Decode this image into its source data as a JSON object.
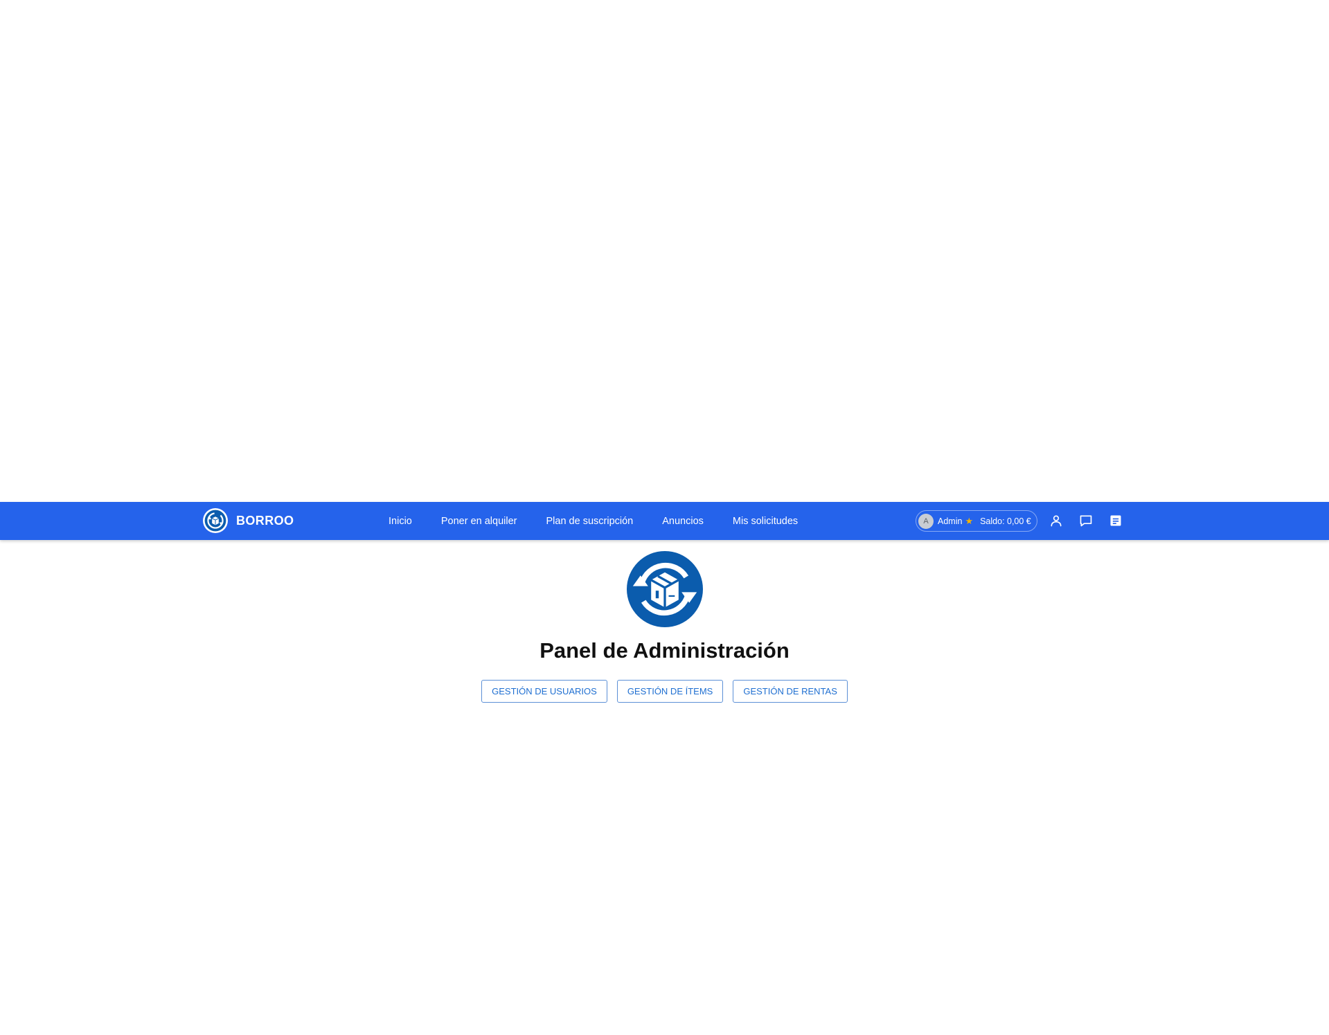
{
  "brand": {
    "name": "BORROO",
    "logo_icon": "borroo-box-cycle-icon"
  },
  "nav": {
    "links": [
      {
        "label": "Inicio"
      },
      {
        "label": "Poner en alquiler"
      },
      {
        "label": "Plan de suscripción"
      },
      {
        "label": "Anuncios"
      },
      {
        "label": "Mis solicitudes"
      }
    ]
  },
  "user": {
    "avatar_initial": "A",
    "name": "Admin",
    "star": "★",
    "balance": "Saldo: 0,00 €"
  },
  "header_icons": [
    "user-icon",
    "chat-icon",
    "document-icon"
  ],
  "main": {
    "title": "Panel de Administración",
    "buttons": [
      {
        "label": "GESTIÓN DE USUARIOS"
      },
      {
        "label": "GESTIÓN DE ÍTEMS"
      },
      {
        "label": "GESTIÓN DE RENTAS"
      }
    ]
  },
  "colors": {
    "navbar": "#2563eb",
    "logo_blue": "#0b5cad",
    "button_text": "#1f6fd1",
    "star": "#f5b400"
  }
}
